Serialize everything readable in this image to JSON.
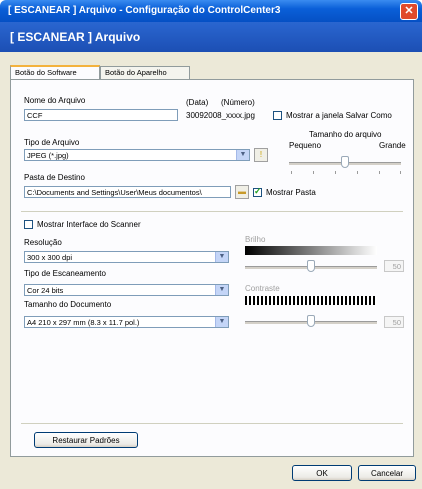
{
  "window": {
    "title": "[ ESCANEAR ] Arquivo - Configuração do ControlCenter3",
    "close_label": "✕",
    "banner": "[ ESCANEAR ] Arquivo"
  },
  "tabs": [
    {
      "label": "Botão do Software",
      "active": true
    },
    {
      "label": "Botão do Aparelho",
      "active": false
    }
  ],
  "file": {
    "name_label": "Nome do Arquivo",
    "name_value": "CCF",
    "data_label": "(Data)",
    "numero_label": "(Número)",
    "suffix": "30092008_xxxx.jpg",
    "show_save_as_label": "Mostrar a janela Salvar Como",
    "show_save_as_checked": false,
    "type_label": "Tipo de Arquivo",
    "type_value": "JPEG (*.jpg)",
    "size_label": "Tamanho do arquivo",
    "size_small": "Pequeno",
    "size_large": "Grande",
    "size_level": 0.5,
    "dest_label": "Pasta de Destino",
    "dest_value": "C:\\Documents and Settings\\User\\Meus documentos\\",
    "show_folder_label": "Mostrar Pasta",
    "show_folder_checked": true
  },
  "scanner": {
    "show_interface_label": "Mostrar Interface do Scanner",
    "show_interface_checked": false,
    "resolution_label": "Resolução",
    "resolution_value": "300 x 300 dpi",
    "scan_type_label": "Tipo de Escaneamento",
    "scan_type_value": "Cor 24 bits",
    "doc_size_label": "Tamanho do Documento",
    "doc_size_value": "A4 210 x 297 mm (8.3 x 11.7 pol.)",
    "brightness_label": "Brilho",
    "brightness_value": "50",
    "contrast_label": "Contraste",
    "contrast_value": "50"
  },
  "buttons": {
    "restore": "Restaurar Padrões",
    "ok": "OK",
    "cancel": "Cancelar"
  }
}
